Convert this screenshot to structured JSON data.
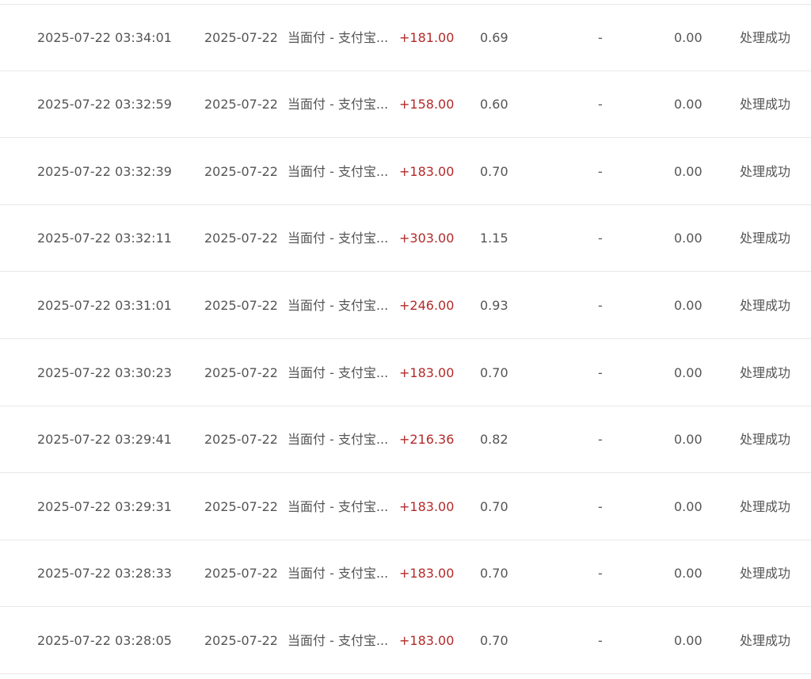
{
  "rows": [
    {
      "time": "2025-07-22 03:34:01",
      "date": "2025-07-22",
      "type": "当面付 - 支付宝...",
      "amount": "+181.00",
      "fee": "0.69",
      "dash": "-",
      "refund": "0.00",
      "status": "处理成功"
    },
    {
      "time": "2025-07-22 03:32:59",
      "date": "2025-07-22",
      "type": "当面付 - 支付宝...",
      "amount": "+158.00",
      "fee": "0.60",
      "dash": "-",
      "refund": "0.00",
      "status": "处理成功"
    },
    {
      "time": "2025-07-22 03:32:39",
      "date": "2025-07-22",
      "type": "当面付 - 支付宝...",
      "amount": "+183.00",
      "fee": "0.70",
      "dash": "-",
      "refund": "0.00",
      "status": "处理成功"
    },
    {
      "time": "2025-07-22 03:32:11",
      "date": "2025-07-22",
      "type": "当面付 - 支付宝...",
      "amount": "+303.00",
      "fee": "1.15",
      "dash": "-",
      "refund": "0.00",
      "status": "处理成功"
    },
    {
      "time": "2025-07-22 03:31:01",
      "date": "2025-07-22",
      "type": "当面付 - 支付宝...",
      "amount": "+246.00",
      "fee": "0.93",
      "dash": "-",
      "refund": "0.00",
      "status": "处理成功"
    },
    {
      "time": "2025-07-22 03:30:23",
      "date": "2025-07-22",
      "type": "当面付 - 支付宝...",
      "amount": "+183.00",
      "fee": "0.70",
      "dash": "-",
      "refund": "0.00",
      "status": "处理成功"
    },
    {
      "time": "2025-07-22 03:29:41",
      "date": "2025-07-22",
      "type": "当面付 - 支付宝...",
      "amount": "+216.36",
      "fee": "0.82",
      "dash": "-",
      "refund": "0.00",
      "status": "处理成功"
    },
    {
      "time": "2025-07-22 03:29:31",
      "date": "2025-07-22",
      "type": "当面付 - 支付宝...",
      "amount": "+183.00",
      "fee": "0.70",
      "dash": "-",
      "refund": "0.00",
      "status": "处理成功"
    },
    {
      "time": "2025-07-22 03:28:33",
      "date": "2025-07-22",
      "type": "当面付 - 支付宝...",
      "amount": "+183.00",
      "fee": "0.70",
      "dash": "-",
      "refund": "0.00",
      "status": "处理成功"
    },
    {
      "time": "2025-07-22 03:28:05",
      "date": "2025-07-22",
      "type": "当面付 - 支付宝...",
      "amount": "+183.00",
      "fee": "0.70",
      "dash": "-",
      "refund": "0.00",
      "status": "处理成功"
    }
  ],
  "colors": {
    "amount": "#b42a2a",
    "text": "#555555",
    "divider": "#e8e8e8"
  }
}
